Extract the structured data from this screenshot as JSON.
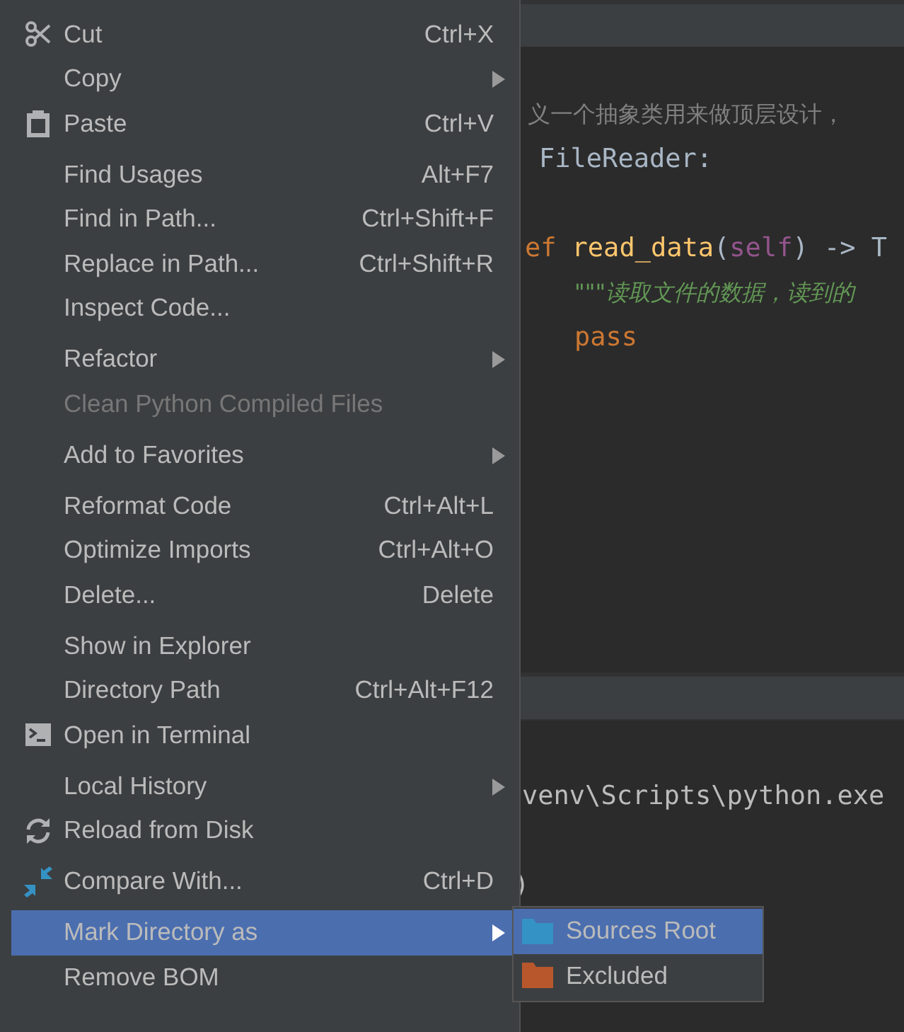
{
  "editor": {
    "lines": [
      {
        "kind": "comment",
        "tokens": [
          {
            "kind": "comment",
            "text": "义一个抽象类用来做顶层设计，"
          }
        ]
      },
      {
        "kind": "class",
        "tokens": [
          {
            "kind": "plain",
            "text": "FileReader:"
          }
        ]
      },
      {
        "kind": "blank"
      },
      {
        "kind": "def",
        "tokens": [
          {
            "kind": "keyword",
            "text": "ef"
          },
          {
            "kind": "function",
            "text": "read_data"
          },
          {
            "kind": "plain",
            "text": "("
          },
          {
            "kind": "self",
            "text": "self"
          },
          {
            "kind": "plain",
            "text": ") -> T"
          }
        ]
      },
      {
        "kind": "body",
        "tokens": [
          {
            "kind": "docstring",
            "text": "\"\"\"读取文件的数据，读到的"
          }
        ]
      },
      {
        "kind": "body",
        "tokens": [
          {
            "kind": "keyword",
            "text": "pass"
          }
        ]
      }
    ]
  },
  "terminal": {
    "lines": [
      {
        "kind": "command",
        "text": "venv\\Scripts\\python.exe"
      },
      {
        "kind": "blank"
      },
      {
        "kind": "output",
        "text": ")"
      }
    ]
  },
  "menu": {
    "items": [
      {
        "kind": "separator"
      },
      {
        "kind": "cut",
        "label": "Cut",
        "shortcut": "Ctrl+X",
        "submenu": false,
        "disabled": false,
        "selected": false
      },
      {
        "kind": "item",
        "label": "Copy",
        "submenu": true,
        "disabled": false,
        "selected": false
      },
      {
        "kind": "paste",
        "label": "Paste",
        "shortcut": "Ctrl+V",
        "submenu": false,
        "disabled": false,
        "selected": false
      },
      {
        "kind": "separator"
      },
      {
        "kind": "item",
        "label": "Find Usages",
        "shortcut": "Alt+F7",
        "submenu": false,
        "disabled": false,
        "selected": false
      },
      {
        "kind": "item",
        "label": "Find in Path...",
        "shortcut": "Ctrl+Shift+F",
        "submenu": false,
        "disabled": false,
        "selected": false
      },
      {
        "kind": "item",
        "label": "Replace in Path...",
        "shortcut": "Ctrl+Shift+R",
        "submenu": false,
        "disabled": false,
        "selected": false
      },
      {
        "kind": "item",
        "label": "Inspect Code...",
        "submenu": false,
        "disabled": false,
        "selected": false
      },
      {
        "kind": "separator"
      },
      {
        "kind": "item",
        "label": "Refactor",
        "submenu": true,
        "disabled": false,
        "selected": false
      },
      {
        "kind": "item",
        "label": "Clean Python Compiled Files",
        "submenu": false,
        "disabled": true,
        "selected": false
      },
      {
        "kind": "separator"
      },
      {
        "kind": "item",
        "label": "Add to Favorites",
        "submenu": true,
        "disabled": false,
        "selected": false
      },
      {
        "kind": "separator"
      },
      {
        "kind": "item",
        "label": "Reformat Code",
        "shortcut": "Ctrl+Alt+L",
        "submenu": false,
        "disabled": false,
        "selected": false
      },
      {
        "kind": "item",
        "label": "Optimize Imports",
        "shortcut": "Ctrl+Alt+O",
        "submenu": false,
        "disabled": false,
        "selected": false
      },
      {
        "kind": "item",
        "label": "Delete...",
        "shortcut": "Delete",
        "submenu": false,
        "disabled": false,
        "selected": false
      },
      {
        "kind": "separator"
      },
      {
        "kind": "item",
        "label": "Show in Explorer",
        "submenu": false,
        "disabled": false,
        "selected": false
      },
      {
        "kind": "item",
        "label": "Directory Path",
        "shortcut": "Ctrl+Alt+F12",
        "submenu": false,
        "disabled": false,
        "selected": false
      },
      {
        "kind": "terminal",
        "label": "Open in Terminal",
        "submenu": false,
        "disabled": false,
        "selected": false
      },
      {
        "kind": "separator"
      },
      {
        "kind": "item",
        "label": "Local History",
        "submenu": true,
        "disabled": false,
        "selected": false
      },
      {
        "kind": "reload",
        "label": "Reload from Disk",
        "submenu": false,
        "disabled": false,
        "selected": false
      },
      {
        "kind": "separator"
      },
      {
        "kind": "compare",
        "label": "Compare With...",
        "shortcut": "Ctrl+D",
        "submenu": false,
        "disabled": false,
        "selected": false
      },
      {
        "kind": "separator"
      },
      {
        "kind": "item",
        "label": "Mark Directory as",
        "submenu": true,
        "disabled": false,
        "selected": true
      },
      {
        "kind": "item",
        "label": "Remove BOM",
        "submenu": false,
        "disabled": false,
        "selected": false
      },
      {
        "kind": "separator"
      }
    ]
  },
  "submenu": {
    "items": [
      {
        "label": "Sources Root",
        "color": "#3592c4",
        "selected": true
      },
      {
        "label": "Excluded",
        "color": "#b8572c",
        "selected": false
      }
    ]
  }
}
